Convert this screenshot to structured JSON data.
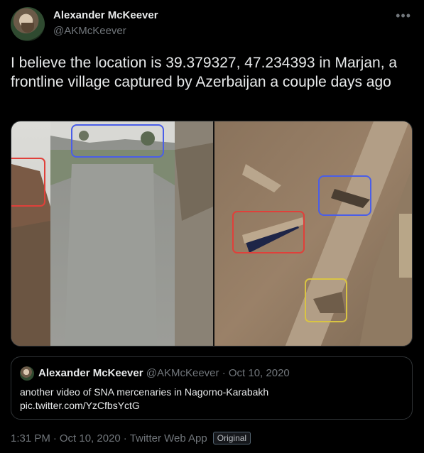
{
  "author": {
    "name": "Alexander McKeever",
    "handle": "@AKMcKeever"
  },
  "more_icon": "•••",
  "tweet": {
    "text": "I believe the location is 39.379327, 47.234393 in Marjan, a frontline village captured by Azerbaijan a couple days ago"
  },
  "quote": {
    "name": "Alexander McKeever",
    "handle": "@AKMcKeever",
    "dot": " · ",
    "date": "Oct 10, 2020",
    "text_line1": "another video of SNA mercenaries in Nagorno-Karabakh",
    "text_line2": "pic.twitter.com/YzCfbsYctG"
  },
  "footer": {
    "time": "1:31 PM",
    "date": "Oct 10, 2020",
    "client": "Twitter Web App",
    "badge": "Original"
  },
  "colors": {
    "background": "#000000",
    "text": "#e7e9ea",
    "muted": "#71767b",
    "border": "#2f3336",
    "box_red": "#e0403a",
    "box_blue": "#4a5ee8",
    "box_yellow": "#d9c443"
  }
}
